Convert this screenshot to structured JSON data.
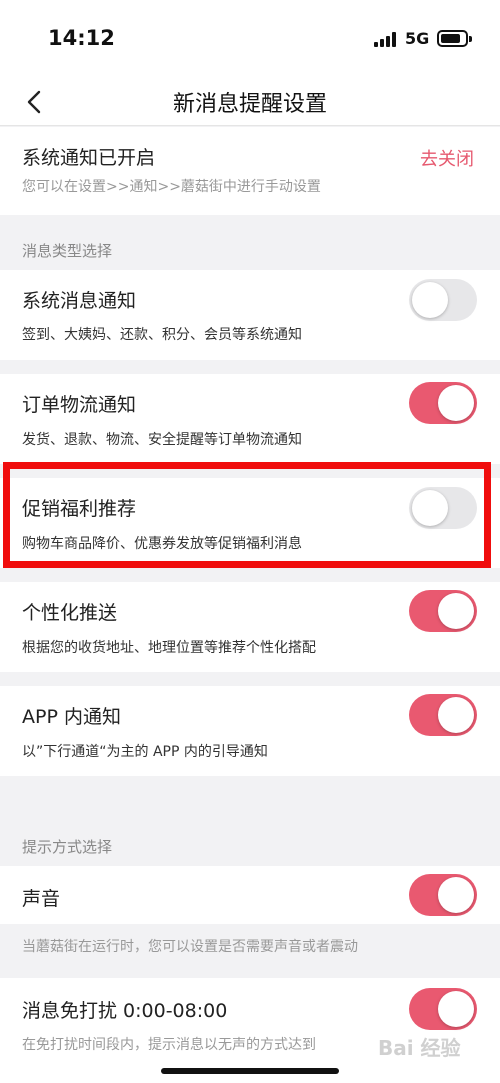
{
  "status_bar": {
    "time": "14:12",
    "network": "5G"
  },
  "nav": {
    "title": "新消息提醒设置"
  },
  "system_notice": {
    "title": "系统通知已开启",
    "action": "去关闭",
    "hint": "您可以在设置>>通知>>蘑菇街中进行手动设置"
  },
  "message_types": {
    "section_label": "消息类型选择",
    "items": [
      {
        "title": "系统消息通知",
        "desc": "签到、大姨妈、还款、积分、会员等系统通知",
        "enabled": false
      },
      {
        "title": "订单物流通知",
        "desc": "发货、退款、物流、安全提醒等订单物流通知",
        "enabled": true
      },
      {
        "title": "促销福利推荐",
        "desc": "购物车商品降价、优惠券发放等促销福利消息",
        "enabled": false
      },
      {
        "title": "个性化推送",
        "desc": "根据您的收货地址、地理位置等推荐个性化搭配",
        "enabled": true
      },
      {
        "title": "APP 内通知",
        "desc": "以”下行通道“为主的 APP 内的引导通知",
        "enabled": true
      }
    ]
  },
  "reminder_methods": {
    "section_label": "提示方式选择",
    "sound": {
      "title": "声音",
      "desc": "当蘑菇街在运行时，您可以设置是否需要声音或者震动",
      "enabled": true
    },
    "dnd": {
      "title": "消息免打扰 0:00-08:00",
      "desc": "在免打扰时间段内，提示消息以无声的方式达到",
      "enabled": true
    }
  },
  "colors": {
    "accent": "#e95970",
    "highlight": "#f00d0d"
  },
  "watermark": "Bai 经验"
}
